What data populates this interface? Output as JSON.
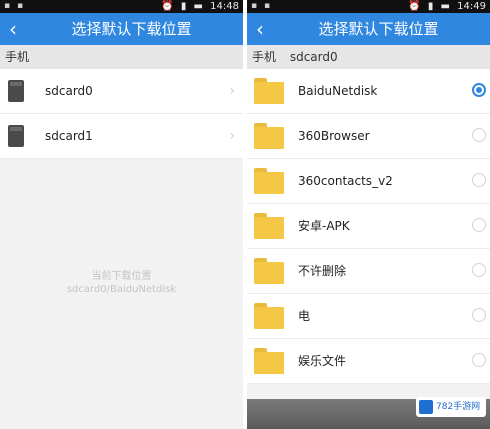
{
  "status_time": "14:48",
  "status_time_right": "14:49",
  "left": {
    "title": "选择默认下载位置",
    "crumbs": [
      "手机"
    ],
    "items": [
      {
        "label": "sdcard0"
      },
      {
        "label": "sdcard1"
      }
    ],
    "hint_line1": "当前下载位置",
    "hint_line2": "sdcard0/BaiduNetdisk"
  },
  "right": {
    "title": "选择默认下载位置",
    "crumbs": [
      "手机",
      "sdcard0"
    ],
    "items": [
      {
        "label": "BaiduNetdisk",
        "selected": true
      },
      {
        "label": "360Browser",
        "selected": false
      },
      {
        "label": "360contacts_v2",
        "selected": false
      },
      {
        "label": "安卓-APK",
        "selected": false
      },
      {
        "label": "不许删除",
        "selected": false
      },
      {
        "label": "电",
        "selected": false
      },
      {
        "label": "娱乐文件",
        "selected": false
      }
    ]
  },
  "watermark": "782手游网",
  "colors": {
    "accent": "#2f87e0",
    "folder": "#f4c844"
  }
}
